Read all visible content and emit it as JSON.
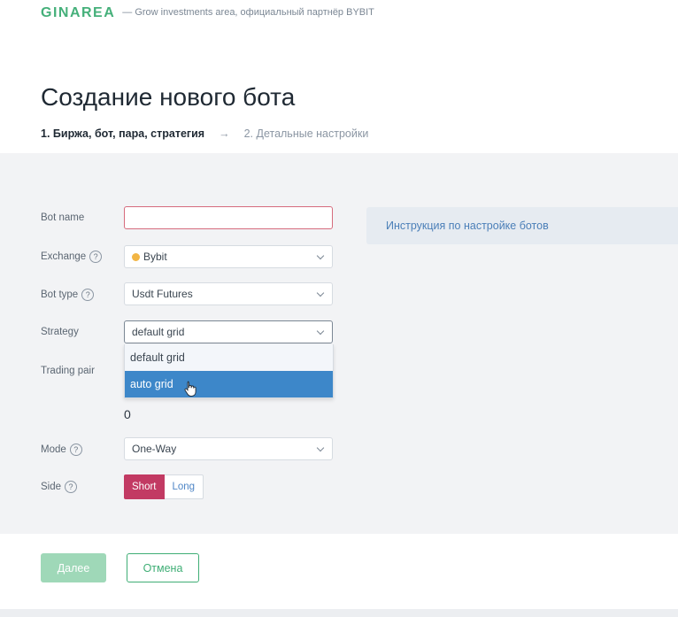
{
  "header": {
    "logo": "GINAREA",
    "tagline": "— Grow investments area, официальный партнёр BYBIT"
  },
  "page": {
    "title": "Создание нового бота",
    "steps": {
      "active": "1. Биржа, бот, пара, стратегия",
      "arrow": "→",
      "next": "2. Детальные настройки"
    }
  },
  "form": {
    "bot_name": {
      "label": "Bot name",
      "value": ""
    },
    "exchange": {
      "label": "Exchange",
      "value": "Bybit",
      "icon": "bybit-coin-icon"
    },
    "bot_type": {
      "label": "Bot type",
      "value": "Usdt Futures"
    },
    "strategy": {
      "label": "Strategy",
      "value": "default grid",
      "options": [
        "default grid",
        "auto grid"
      ]
    },
    "trading_pair": {
      "label": "Trading pair",
      "value_below": "0"
    },
    "mode": {
      "label": "Mode",
      "value": "One-Way"
    },
    "side": {
      "label": "Side",
      "short": "Short",
      "long": "Long",
      "selected": "Short"
    }
  },
  "info": {
    "link": "Инструкция по настройке ботов"
  },
  "actions": {
    "submit": "Далее",
    "cancel": "Отмена"
  },
  "help_glyph": "?",
  "colors": {
    "brand_green": "#45b07a",
    "short_red": "#c23a63",
    "hover_blue": "#3d87c9",
    "link_blue": "#4b7fb8"
  }
}
